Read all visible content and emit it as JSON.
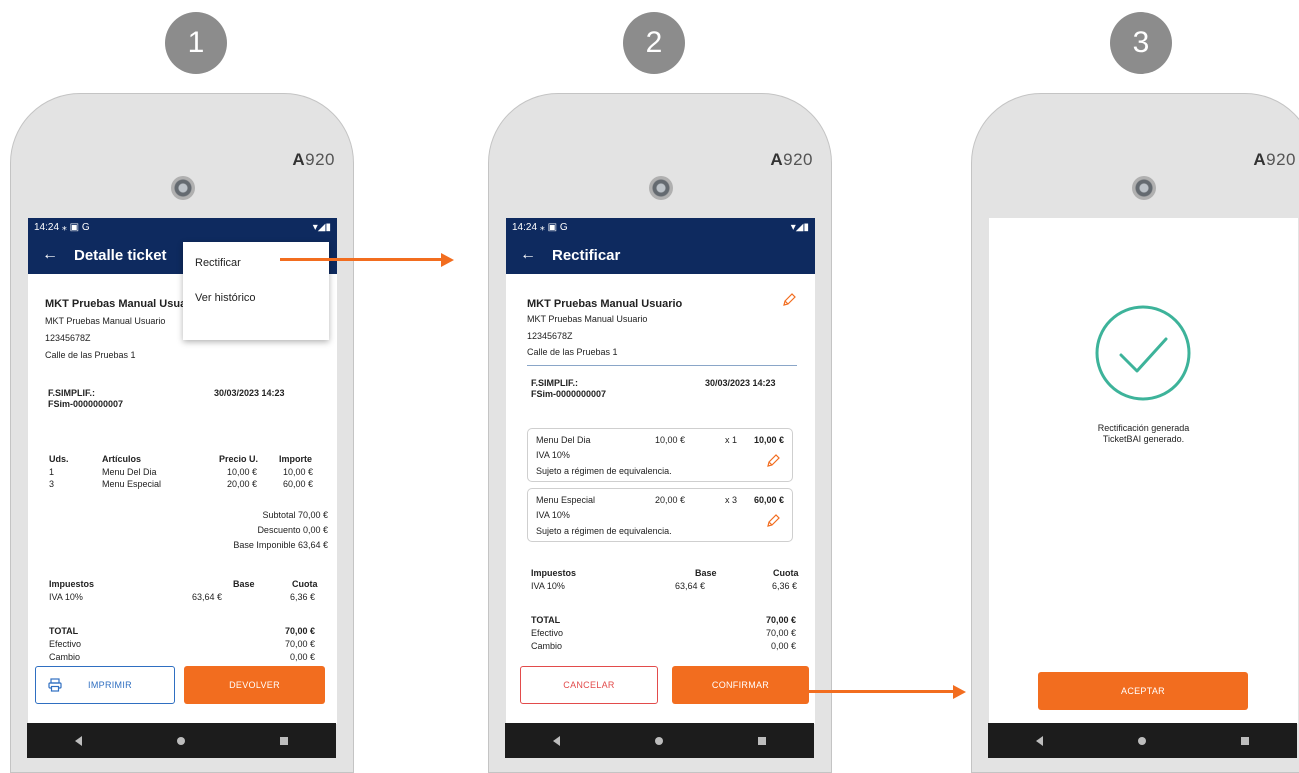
{
  "steps": [
    "1",
    "2",
    "3"
  ],
  "device_brand": {
    "letter": "A",
    "model": "920"
  },
  "status_time": "14:24",
  "status_icons": "⁎ ▣ G",
  "nav_icons": [
    "back-triangle-icon",
    "home-circle-icon",
    "recents-square-icon"
  ],
  "colors": {
    "header": "#0e2a5f",
    "accent": "#f26d1f",
    "success": "#3db39a"
  },
  "screen1": {
    "title": "Detalle ticket",
    "menu": [
      "Rectificar",
      "Ver histórico"
    ],
    "company": "MKT Pruebas Manual Usua",
    "company_sub": "MKT Pruebas Manual Usuario",
    "nif": "12345678Z",
    "address": "Calle de las Pruebas 1",
    "doc_label": "F.SIMPLIF.:",
    "doc_number": "FSim-0000000007",
    "date": "30/03/2023 14:23",
    "table_headers": [
      "Uds.",
      "Artículos",
      "Precio U.",
      "Importe"
    ],
    "rows": [
      {
        "qty": "1",
        "item": "Menu Del Dia",
        "price": "10,00 €",
        "amount": "10,00 €"
      },
      {
        "qty": "3",
        "item": "Menu Especial",
        "price": "20,00 €",
        "amount": "60,00 €"
      }
    ],
    "subtotal": "Subtotal 70,00 €",
    "descuento": "Descuento 0,00 €",
    "base_imponible": "Base Imponible 63,64 €",
    "tax_headers": [
      "Impuestos",
      "Base",
      "Cuota"
    ],
    "tax_row": {
      "name": "IVA 10%",
      "base": "63,64 €",
      "cuota": "6,36 €"
    },
    "total_label": "TOTAL",
    "total_value": "70,00 €",
    "efectivo_label": "Efectivo",
    "efectivo_value": "70,00 €",
    "cambio_label": "Cambio",
    "cambio_value": "0,00 €",
    "btn_print": "IMPRIMIR",
    "btn_return": "DEVOLVER"
  },
  "screen2": {
    "title": "Rectificar",
    "company": "MKT Pruebas Manual Usuario",
    "company_sub": "MKT Pruebas Manual Usuario",
    "nif": "12345678Z",
    "address": "Calle de las Pruebas 1",
    "doc_label": "F.SIMPLIF.:",
    "doc_number": "FSim-0000000007",
    "date": "30/03/2023 14:23",
    "lines": [
      {
        "item": "Menu Del Dia",
        "price": "10,00 €",
        "qty": "x 1",
        "amount": "10,00 €",
        "tax": "IVA 10%",
        "note": "Sujeto a régimen de equivalencia."
      },
      {
        "item": "Menu Especial",
        "price": "20,00 €",
        "qty": "x 3",
        "amount": "60,00 €",
        "tax": "IVA 10%",
        "note": "Sujeto a régimen de equivalencia."
      }
    ],
    "tax_headers": [
      "Impuestos",
      "Base",
      "Cuota"
    ],
    "tax_row": {
      "name": "IVA 10%",
      "base": "63,64 €",
      "cuota": "6,36 €"
    },
    "total_label": "TOTAL",
    "total_value": "70,00 €",
    "efectivo_label": "Efectivo",
    "efectivo_value": "70,00 €",
    "cambio_label": "Cambio",
    "cambio_value": "0,00 €",
    "btn_cancel": "CANCELAR",
    "btn_confirm": "CONFIRMAR"
  },
  "screen3": {
    "message_line1": "Rectificación generada",
    "message_line2": "TicketBAI generado.",
    "btn_accept": "ACEPTAR"
  }
}
